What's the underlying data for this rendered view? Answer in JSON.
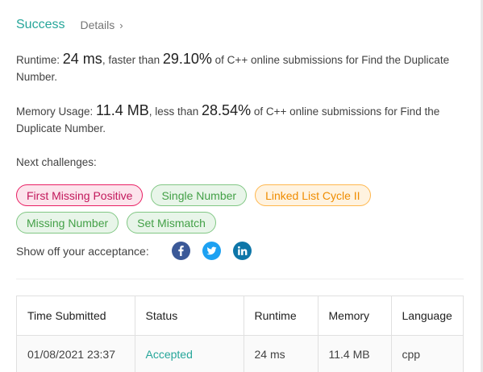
{
  "header": {
    "title": "Success",
    "details_label": "Details",
    "details_chevron": "›"
  },
  "runtime": {
    "label": "Runtime: ",
    "value": "24 ms",
    "comparison": ", faster than ",
    "percent": "29.10%",
    "suffix": " of C++ online submissions for Find the Duplicate Number."
  },
  "memory": {
    "label": "Memory Usage: ",
    "value": "11.4 MB",
    "comparison": ", less than ",
    "percent": "28.54%",
    "suffix": " of C++ online submissions for Find the Duplicate Number."
  },
  "next_challenges": {
    "label": "Next challenges:",
    "items": [
      {
        "label": "First Missing Positive",
        "difficulty": "hard"
      },
      {
        "label": "Single Number",
        "difficulty": "easy"
      },
      {
        "label": "Linked List Cycle II",
        "difficulty": "medium"
      },
      {
        "label": "Missing Number",
        "difficulty": "easy"
      },
      {
        "label": "Set Mismatch",
        "difficulty": "easy"
      }
    ]
  },
  "share": {
    "label": "Show off your acceptance:",
    "icons": [
      "facebook-icon",
      "twitter-icon",
      "linkedin-icon"
    ]
  },
  "submissions": {
    "columns": [
      "Time Submitted",
      "Status",
      "Runtime",
      "Memory",
      "Language"
    ],
    "rows": [
      {
        "time": "01/08/2021 23:37",
        "status": "Accepted",
        "runtime": "24 ms",
        "memory": "11.4 MB",
        "language": "cpp"
      }
    ]
  },
  "colors": {
    "success": "#26a69a",
    "hard": "#e91e63",
    "easy": "#43a047",
    "medium": "#ef8c00",
    "facebook": "#3b5998",
    "twitter": "#1da1f2",
    "linkedin": "#0e76a8"
  }
}
